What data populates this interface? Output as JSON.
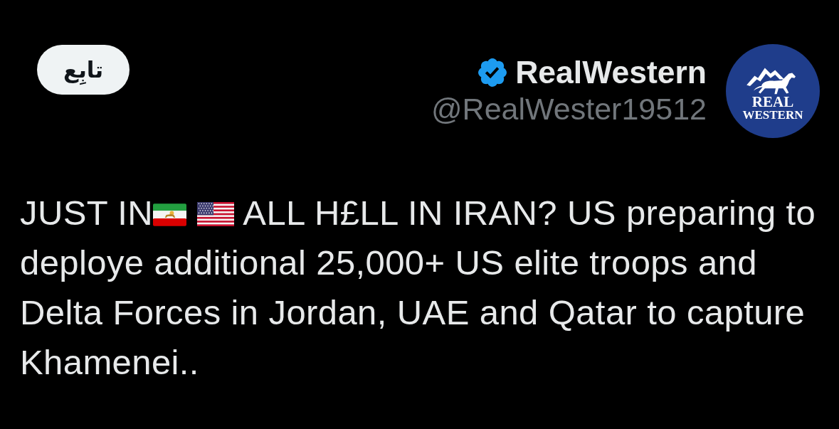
{
  "follow_button": {
    "label": "تابِع"
  },
  "author": {
    "name": "RealWestern",
    "verified": true,
    "handle": "@RealWester19512",
    "avatar_logo_text": [
      "REAL",
      "WESTERN"
    ]
  },
  "post": {
    "lead": "JUST IN",
    "text": "ALL H£LL IN IRAN? US preparing to deploye additional 25,000+ US elite troops and Delta Forces in Jordan, UAE and Qatar to capture Khamenei.."
  }
}
